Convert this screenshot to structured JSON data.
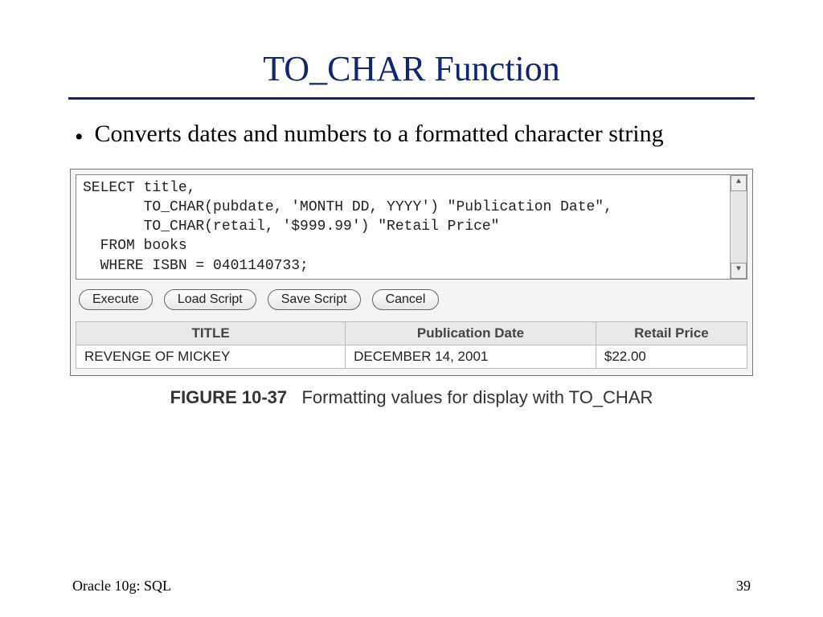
{
  "title": "TO_CHAR Function",
  "bullet": "Converts dates and numbers to a formatted character string",
  "code": "SELECT title,\n       TO_CHAR(pubdate, 'MONTH DD, YYYY') \"Publication Date\",\n       TO_CHAR(retail, '$999.99') \"Retail Price\"\n  FROM books\n  WHERE ISBN = 0401140733;",
  "buttons": {
    "execute": "Execute",
    "load": "Load Script",
    "save": "Save Script",
    "cancel": "Cancel"
  },
  "table": {
    "headers": [
      "TITLE",
      "Publication Date",
      "Retail Price"
    ],
    "row": [
      "REVENGE OF MICKEY",
      "DECEMBER 14, 2001",
      "$22.00"
    ]
  },
  "figure": {
    "number": "FIGURE 10-37",
    "caption": "Formatting values for display with TO_CHAR"
  },
  "footer": {
    "left": "Oracle 10g: SQL",
    "right": "39"
  },
  "scroll": {
    "up": "▲",
    "down": "▼"
  }
}
